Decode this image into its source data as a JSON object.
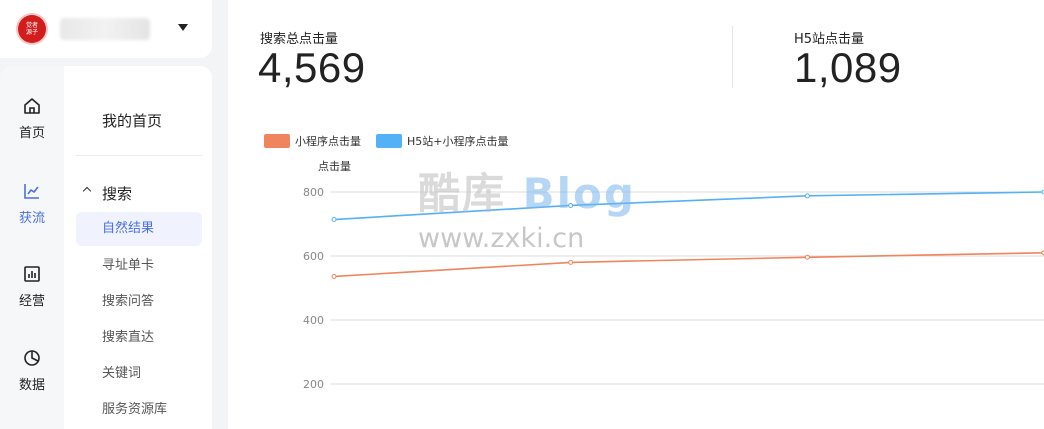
{
  "brand": {
    "logo_text": "觉者\n源子"
  },
  "rail": [
    {
      "id": "home",
      "label": "首页",
      "icon": "home-icon"
    },
    {
      "id": "traffic",
      "label": "获流",
      "icon": "trend-icon",
      "active": true
    },
    {
      "id": "operate",
      "label": "经营",
      "icon": "bar-chart-icon"
    },
    {
      "id": "data",
      "label": "数据",
      "icon": "pie-chart-icon"
    }
  ],
  "subnav": {
    "home": "我的首页",
    "group": "搜索",
    "items": [
      "自然结果",
      "寻址单卡",
      "搜索问答",
      "搜索直达",
      "关键词",
      "服务资源库"
    ],
    "active_index": 0
  },
  "metrics": [
    {
      "label": "搜索总点击量",
      "value": "4,569"
    },
    {
      "label": "H5站点击量",
      "value": "1,089"
    }
  ],
  "watermark": {
    "line1_cn": "酷库",
    "line1_en": "Blog",
    "line2": "www.zxki.cn"
  },
  "colors": {
    "accent": "#4b6fe0",
    "series_orange": "#f0845c",
    "series_blue": "#54b1f5"
  },
  "chart_data": {
    "type": "line",
    "ylabel": "点击量",
    "ylim": [
      200,
      800
    ],
    "yticks": [
      "800",
      "600",
      "400",
      "200"
    ],
    "x": [
      0,
      1,
      2,
      3
    ],
    "series": [
      {
        "name": "小程序点击量",
        "values": [
          536,
          580,
          596,
          610
        ]
      },
      {
        "name": "H5站+小程序点击量",
        "values": [
          714,
          758,
          788,
          800
        ]
      }
    ],
    "grid": true,
    "legend": "top-left"
  }
}
